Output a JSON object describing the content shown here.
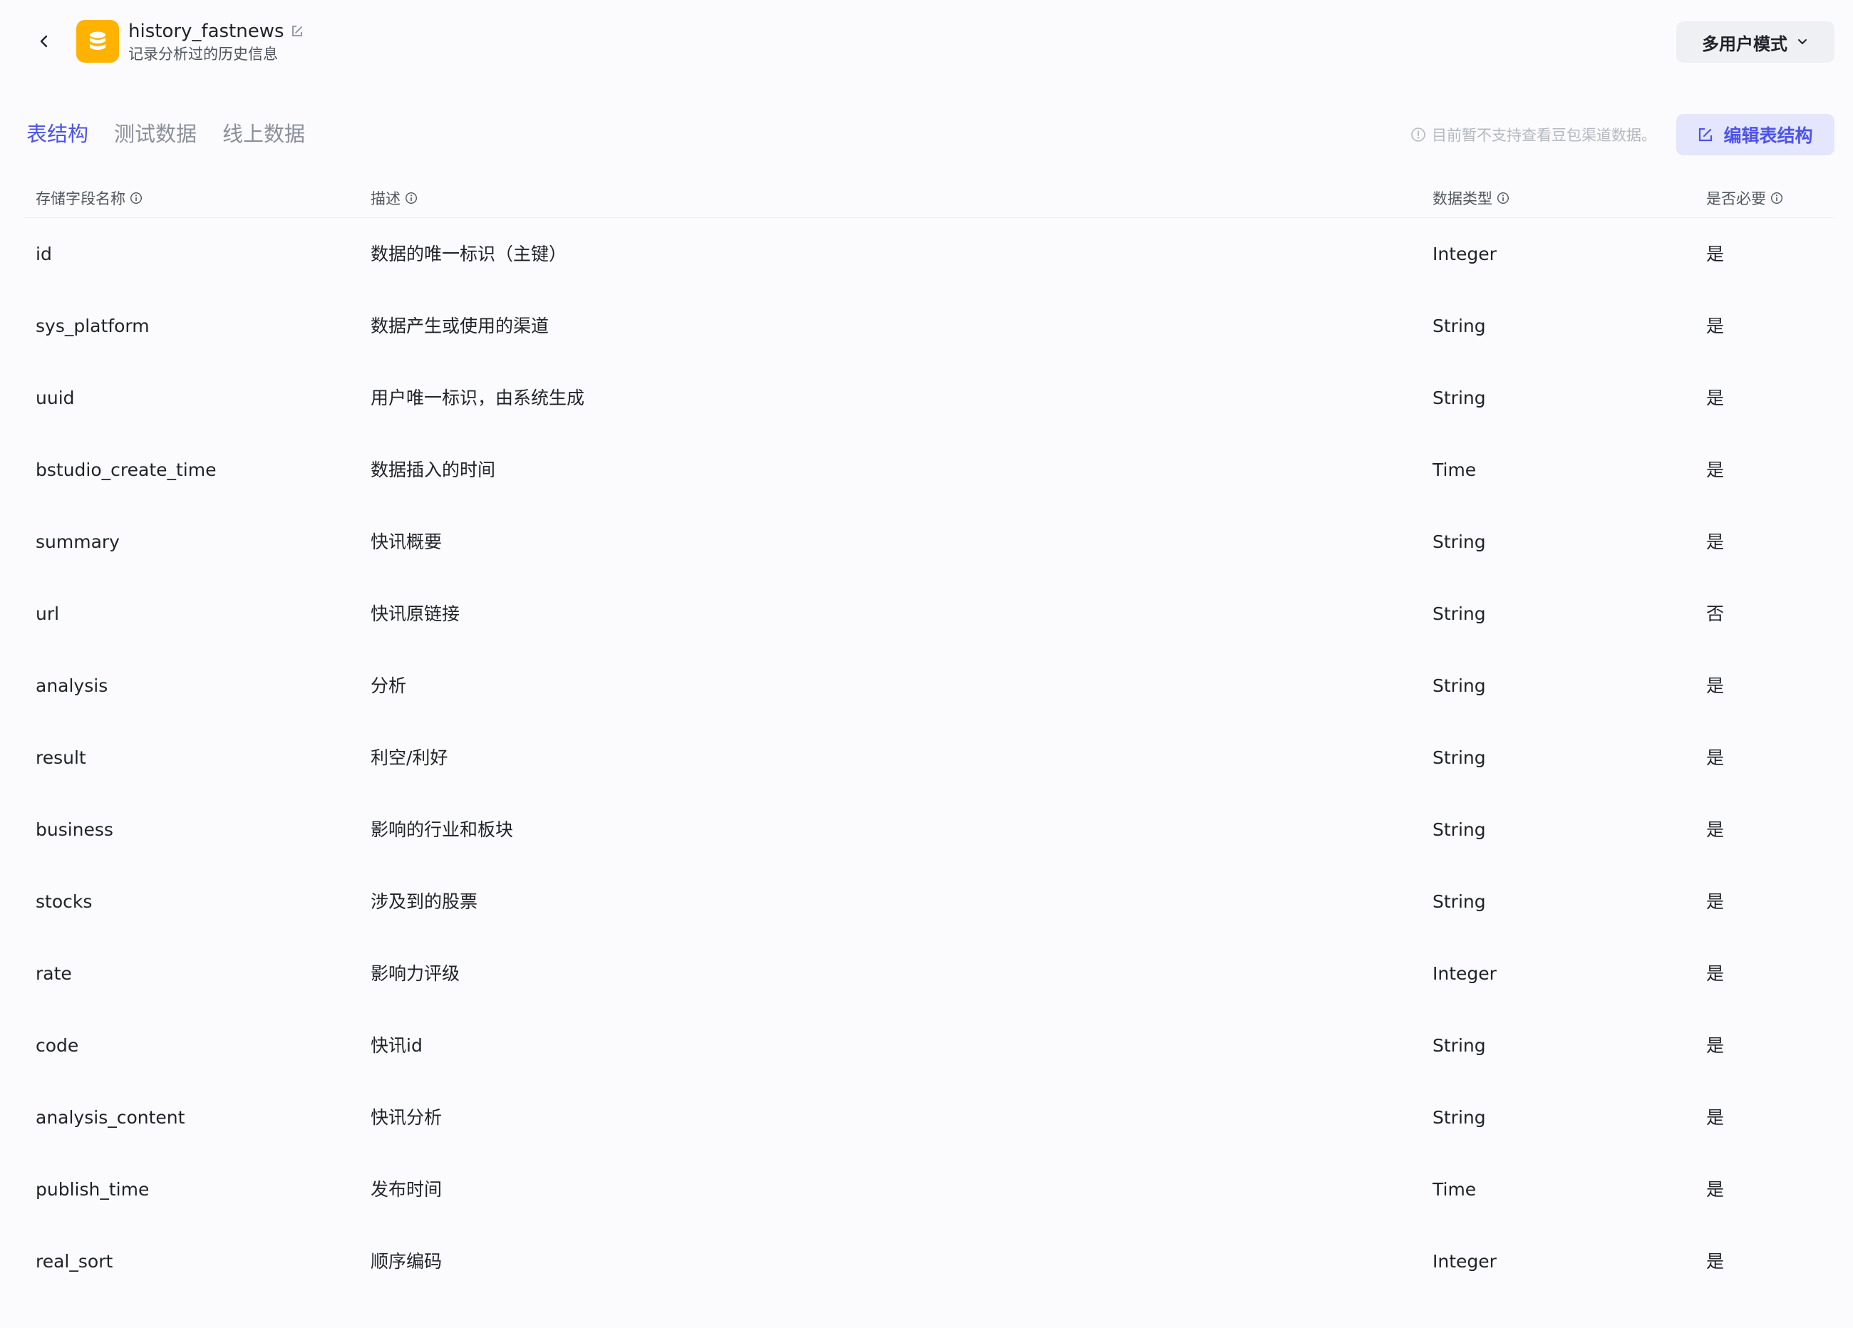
{
  "header": {
    "title": "history_fastnews",
    "subtitle": "记录分析过的历史信息",
    "mode_label": "多用户模式"
  },
  "tabs": [
    {
      "label": "表结构",
      "active": true
    },
    {
      "label": "测试数据",
      "active": false
    },
    {
      "label": "线上数据",
      "active": false
    }
  ],
  "notice": "目前暂不支持查看豆包渠道数据。",
  "edit_button": "编辑表结构",
  "table": {
    "headers": [
      "存储字段名称",
      "描述",
      "数据类型",
      "是否必要"
    ],
    "rows": [
      {
        "name": "id",
        "desc": "数据的唯一标识（主键）",
        "type": "Integer",
        "required": "是"
      },
      {
        "name": "sys_platform",
        "desc": "数据产生或使用的渠道",
        "type": "String",
        "required": "是"
      },
      {
        "name": "uuid",
        "desc": "用户唯一标识，由系统生成",
        "type": "String",
        "required": "是"
      },
      {
        "name": "bstudio_create_time",
        "desc": "数据插入的时间",
        "type": "Time",
        "required": "是"
      },
      {
        "name": "summary",
        "desc": "快讯概要",
        "type": "String",
        "required": "是"
      },
      {
        "name": "url",
        "desc": "快讯原链接",
        "type": "String",
        "required": "否"
      },
      {
        "name": "analysis",
        "desc": "分析",
        "type": "String",
        "required": "是"
      },
      {
        "name": "result",
        "desc": "利空/利好",
        "type": "String",
        "required": "是"
      },
      {
        "name": "business",
        "desc": "影响的行业和板块",
        "type": "String",
        "required": "是"
      },
      {
        "name": "stocks",
        "desc": "涉及到的股票",
        "type": "String",
        "required": "是"
      },
      {
        "name": "rate",
        "desc": "影响力评级",
        "type": "Integer",
        "required": "是"
      },
      {
        "name": "code",
        "desc": "快讯id",
        "type": "String",
        "required": "是"
      },
      {
        "name": "analysis_content",
        "desc": "快讯分析",
        "type": "String",
        "required": "是"
      },
      {
        "name": "publish_time",
        "desc": "发布时间",
        "type": "Time",
        "required": "是"
      },
      {
        "name": "real_sort",
        "desc": "顺序编码",
        "type": "Integer",
        "required": "是"
      }
    ]
  },
  "colors": {
    "accent": "#4d53e8",
    "logo": "#ffb300"
  }
}
